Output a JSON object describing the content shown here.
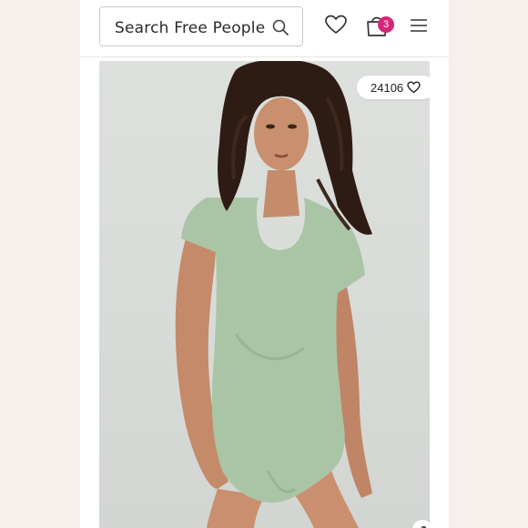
{
  "search": {
    "placeholder": "Search Free People"
  },
  "header": {
    "icons": [
      "search-icon",
      "heart-icon",
      "bag-icon",
      "menu-icon"
    ],
    "bag_count": "3"
  },
  "product": {
    "like_count": "24106",
    "image_description": "model wearing sage green cap-sleeve square-neck bodysuit"
  },
  "colors": {
    "background": "#f7efec",
    "badge": "#d4277a",
    "bodysuit": "#a9c5a6",
    "image_backdrop": "#dadcd8"
  }
}
